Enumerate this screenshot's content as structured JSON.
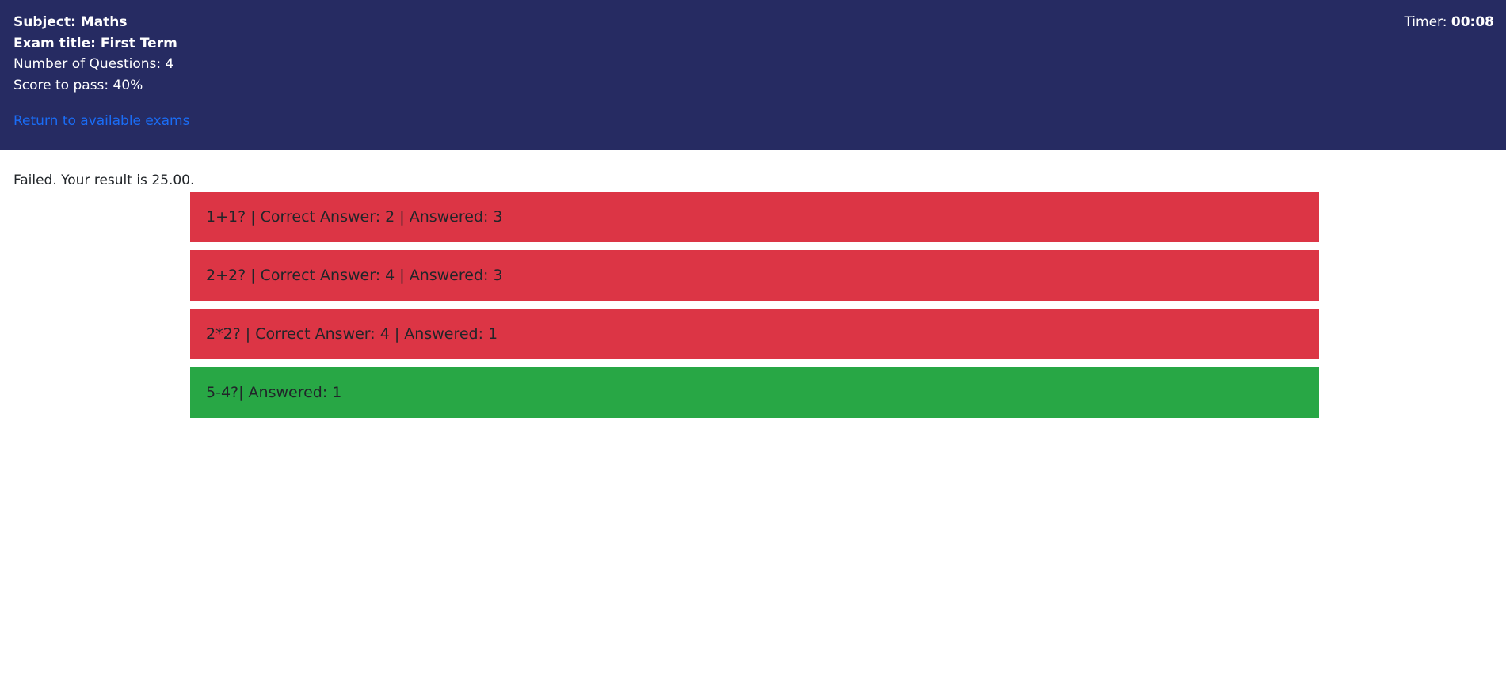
{
  "header": {
    "subject": "Subject: Maths",
    "exam_title": "Exam title: First Term",
    "num_questions": "Number of Questions: 4",
    "pass_score": "Score to pass: 40%",
    "return_link": "Return to available exams",
    "timer_label": "Timer:",
    "timer_value": "00:08",
    "background_color": "#262b62"
  },
  "result": {
    "text": "Failed. Your result is 25.00."
  },
  "answers": [
    {
      "text": "1+1? | Correct Answer: 2 | Answered: 3",
      "status": "incorrect",
      "color": "#dc3545"
    },
    {
      "text": "2+2? | Correct Answer: 4 | Answered: 3",
      "status": "incorrect",
      "color": "#dc3545"
    },
    {
      "text": "2*2? | Correct Answer: 4 | Answered: 1",
      "status": "incorrect",
      "color": "#dc3545"
    },
    {
      "text": "5-4?| Answered: 1",
      "status": "correct",
      "color": "#28a745"
    }
  ]
}
